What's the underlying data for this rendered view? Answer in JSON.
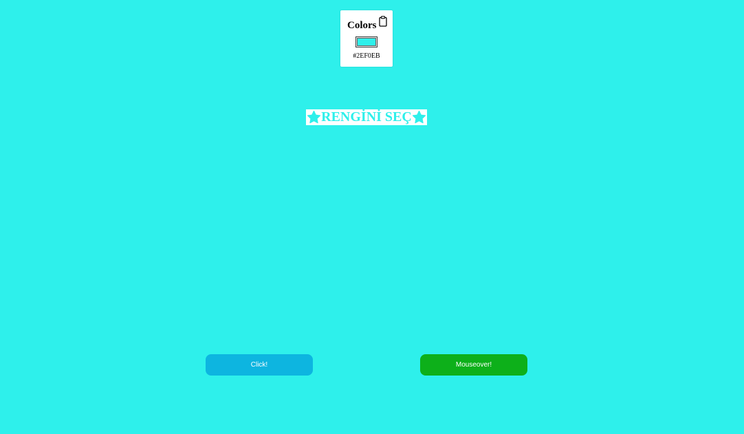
{
  "colors_card": {
    "title": "Colors",
    "hex_value": "#2EF0EB",
    "hex_label": "#2EF0EB",
    "copy_icon": "clipboard-icon"
  },
  "heading": {
    "text": "RENGİNİ SEÇ",
    "left_icon": "star-icon",
    "right_icon": "star-icon"
  },
  "buttons": {
    "click_label": "Click!",
    "mouseover_label": "Mouseover!"
  },
  "colors": {
    "page_background": "#2EF0EB",
    "heading_text": "#2EF0EB",
    "click_button": "#0DB5E0",
    "mouseover_button": "#0DB01A"
  }
}
